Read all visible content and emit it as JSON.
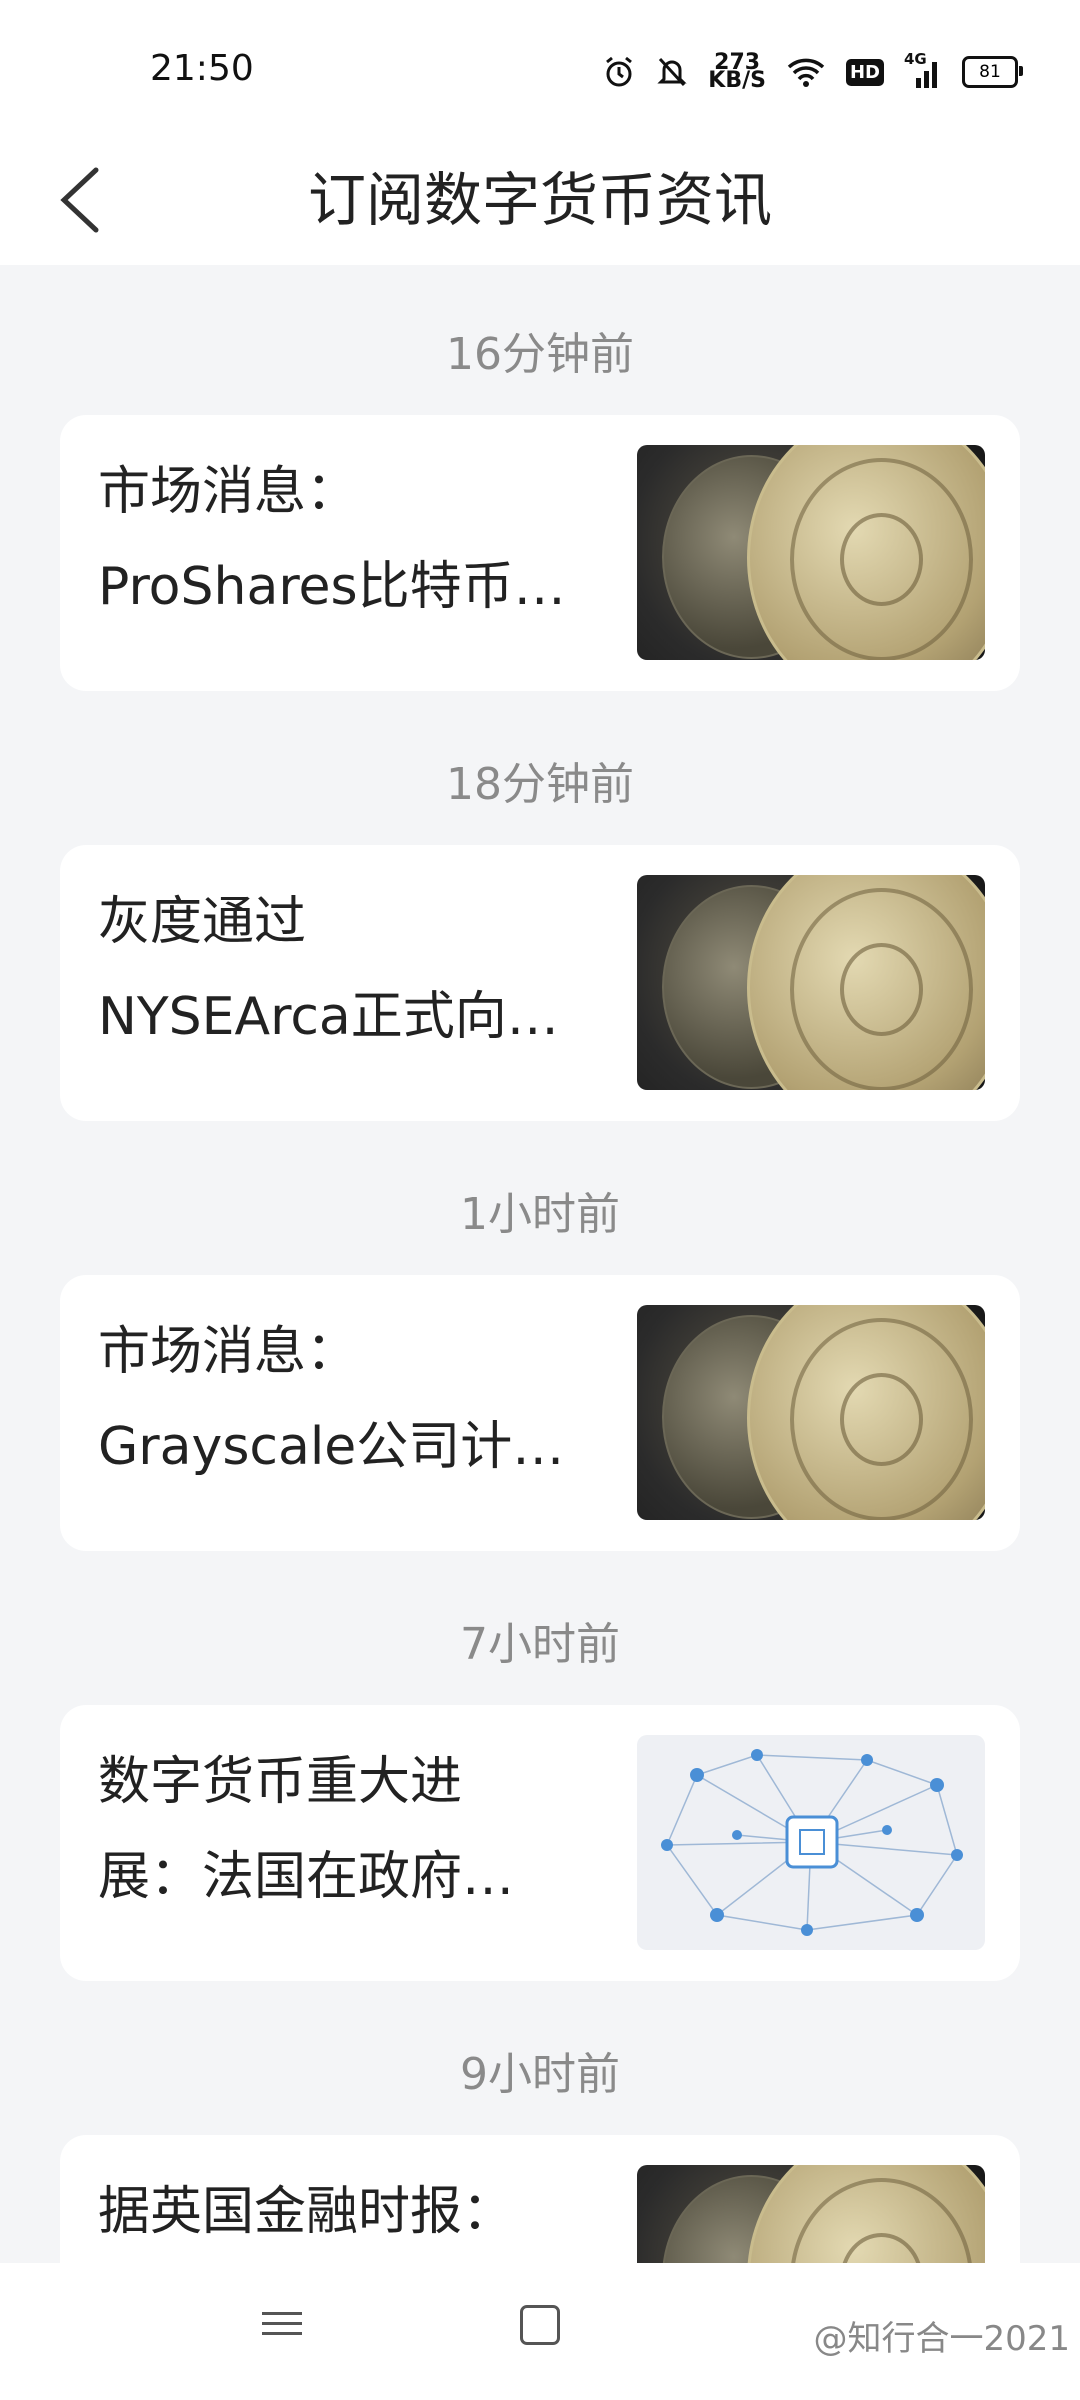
{
  "status_bar": {
    "time": "21:50",
    "net_speed_value": "273",
    "net_speed_unit": "KB/S",
    "hd_label": "HD",
    "network_label": "4G",
    "battery": "81"
  },
  "header": {
    "back_icon": "chevron-left-icon",
    "title": "订阅数字货币资讯"
  },
  "feed": [
    {
      "time": "16分钟前",
      "line1": "市场消息：",
      "line2": "ProShares比特币…",
      "thumb": "coin"
    },
    {
      "time": "18分钟前",
      "line1": "灰度通过",
      "line2": "NYSEArca正式向…",
      "thumb": "coin"
    },
    {
      "time": "1小时前",
      "line1": "市场消息：",
      "line2": "Grayscale公司计…",
      "thumb": "coin"
    },
    {
      "time": "7小时前",
      "line1": "数字货币重大进",
      "line2": "展：法国在政府…",
      "thumb": "network"
    },
    {
      "time": "9小时前",
      "line1": "据英国金融时报：",
      "line2": "",
      "thumb": "coin"
    }
  ],
  "nav_bar": {
    "menu_icon": "menu-icon",
    "home_icon": "home-square-icon"
  },
  "watermark": "@知行合一2021"
}
